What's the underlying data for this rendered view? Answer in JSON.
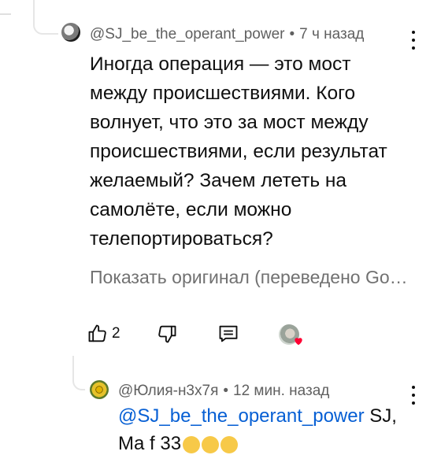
{
  "comment": {
    "author": "@SJ_be_the_operant_power",
    "separator": "•",
    "time": "7 ч назад",
    "text": "Иногда операция — это мост между происшествиями. Кого волнует, что это за мост между происшествиями, если результат желаемый? Зачем лететь на самолёте, если можно телепортироваться?",
    "translate_link": "Показать оригинал (переведено Go…",
    "like_count": "2"
  },
  "reply": {
    "author": "@Юлия-н3х7я",
    "separator": "•",
    "time": "12 мин. назад",
    "mention": "@SJ_be_the_operant_power",
    "text_after_mention": " SJ,",
    "line2_partial": "Ma  f   33"
  },
  "icons": {
    "like": "thumbs-up-icon",
    "dislike": "thumbs-down-icon",
    "reply": "reply-icon",
    "menu": "more-vert-icon",
    "heart": "creator-heart-icon"
  },
  "colors": {
    "mention": "#065fd4",
    "meta": "#606060",
    "heart": "#ff0033"
  }
}
